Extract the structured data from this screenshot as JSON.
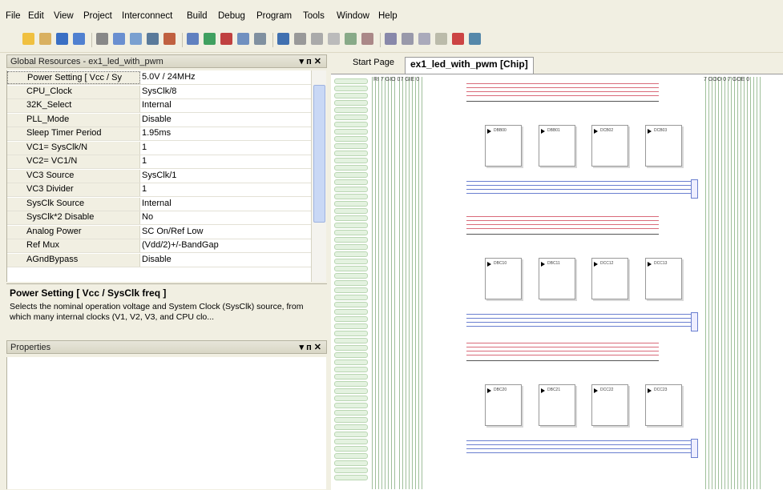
{
  "menu": [
    "File",
    "Edit",
    "View",
    "Project",
    "Interconnect",
    "Build",
    "Debug",
    "Program",
    "Tools",
    "Window",
    "Help"
  ],
  "global_resources": {
    "title": "Global Resources - ex1_led_with_pwm",
    "controls": "▾ ᴨ ✕",
    "rows": [
      {
        "name": "Power Setting [ Vcc / Sy",
        "value": "5.0V / 24MHz"
      },
      {
        "name": "CPU_Clock",
        "value": "SysClk/8"
      },
      {
        "name": "32K_Select",
        "value": "Internal"
      },
      {
        "name": "PLL_Mode",
        "value": "Disable"
      },
      {
        "name": "Sleep Timer Period",
        "value": "1.95ms"
      },
      {
        "name": "VC1= SysClk/N",
        "value": "1"
      },
      {
        "name": "VC2= VC1/N",
        "value": "1"
      },
      {
        "name": "VC3 Source",
        "value": "SysClk/1"
      },
      {
        "name": "VC3 Divider",
        "value": "1"
      },
      {
        "name": "SysClk Source",
        "value": "Internal"
      },
      {
        "name": "SysClk*2 Disable",
        "value": "No"
      },
      {
        "name": "Analog Power",
        "value": "SC On/Ref Low"
      },
      {
        "name": "Ref Mux",
        "value": "(Vdd/2)+/-BandGap"
      },
      {
        "name": "AGndBypass",
        "value": "Disable"
      }
    ],
    "description_title": "Power Setting [ Vcc / SysClk freq ]",
    "description_text": "Selects the nominal operation voltage and System Clock (SysClk) source, from which many internal clocks (V1, V2, V3, and CPU clo..."
  },
  "properties": {
    "title": "Properties",
    "controls": "▾ ᴨ ✕"
  },
  "tabs": [
    {
      "label": "Start Page"
    },
    {
      "label": "ex1_led_with_pwm [Chip]"
    }
  ],
  "chip": {
    "top_labels_left": "RI 7  GIO  07  GIE  0",
    "top_labels_right": "7  GOO  0 7  GOE  0",
    "rows": [
      {
        "digital": [
          "DBB00",
          "DBB01",
          "DCB02",
          "DCB03"
        ]
      },
      {
        "digital": [
          "DBC10",
          "DBC11",
          "DCC12",
          "DCC13"
        ]
      },
      {
        "digital": [
          "DBC20",
          "DBC21",
          "DCC22",
          "DCC23"
        ]
      }
    ]
  },
  "colors": {
    "pink": "#d96b7a",
    "blue": "#6a7fd0",
    "green": "#9fbf9a",
    "bg": "#f1efe2"
  }
}
